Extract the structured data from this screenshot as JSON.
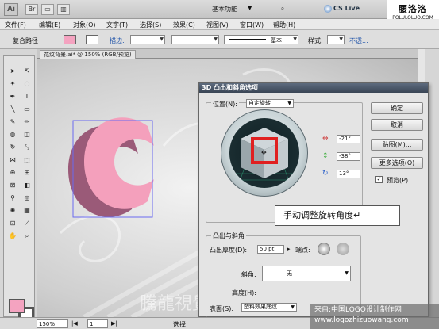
{
  "titlebar": {
    "logo": "Ai",
    "workspace": "基本功能",
    "cslive": "CS Live",
    "watermark_big": "腰洛洛",
    "watermark_small": "POLULOLUO.COM"
  },
  "menu": [
    "文件(F)",
    "编辑(E)",
    "对象(O)",
    "文字(T)",
    "选择(S)",
    "效果(C)",
    "视图(V)",
    "窗口(W)",
    "帮助(H)"
  ],
  "control_bar": {
    "path_label": "复合路径",
    "stroke_label": "描边:",
    "style_basic": "基本",
    "style_label": "样式:",
    "opacity_label": "不透..."
  },
  "doc_tab": "花纹背景.ai* @ 150% (RGB/预览)",
  "status": {
    "zoom": "150%",
    "page": "1",
    "tool": "选择"
  },
  "dialog": {
    "title": "3D 凸出和斜角选项",
    "position_label": "位置(N):",
    "position_value": "自定旋转",
    "rot_x": "-21°",
    "rot_y": "-38°",
    "rot_z": "13°",
    "ok": "确定",
    "cancel": "取消",
    "map": "贴图(M)...",
    "more": "更多选项(O)",
    "preview": "预览(P)",
    "extrude_group": "凸出与斜角",
    "depth_label": "凸出厚度(D):",
    "depth_value": "50 pt",
    "cap_label": "端点:",
    "bevel_label": "斜角:",
    "bevel_value": "无",
    "height_label": "高度(H):",
    "surface_label": "表面(S):",
    "surface_value": "塑料效果底纹"
  },
  "callout": "手动调整旋转角度↵",
  "bottom_watermark": {
    "line1": "来自:中国LOGO设计制作网",
    "line2": "www.logozhizuowang.com"
  },
  "canvas_watermark": "騰龍視覺",
  "colors": {
    "fill": "#f4a3c0",
    "letter_front": "#f4a0bc",
    "letter_side": "#9a5a78",
    "cube_red": "#e02020",
    "dialog_title": "#394555"
  }
}
